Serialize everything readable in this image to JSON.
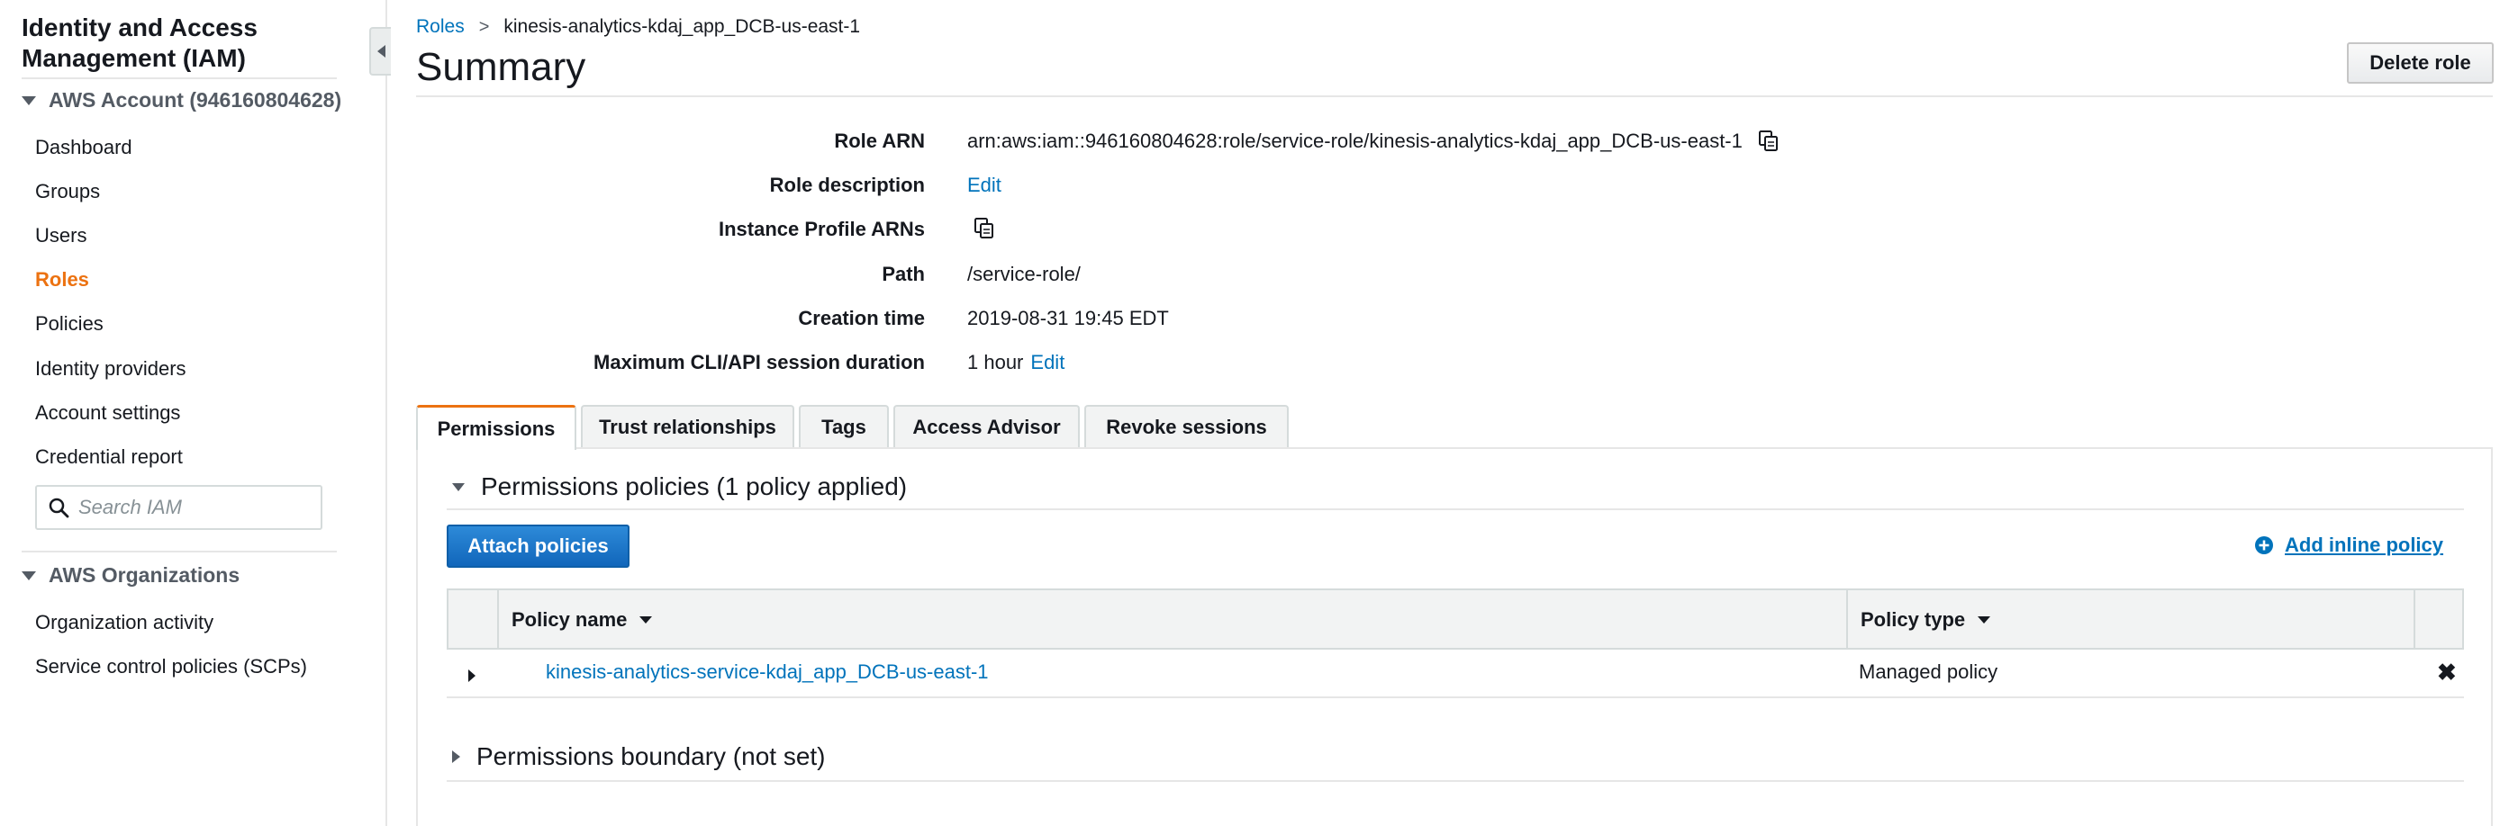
{
  "sidebar": {
    "title": "Identity and Access Management (IAM)",
    "account_group": "AWS Account (946160804628)",
    "items": [
      {
        "label": "Dashboard"
      },
      {
        "label": "Groups"
      },
      {
        "label": "Users"
      },
      {
        "label": "Roles",
        "active": true
      },
      {
        "label": "Policies"
      },
      {
        "label": "Identity providers"
      },
      {
        "label": "Account settings"
      },
      {
        "label": "Credential report"
      }
    ],
    "search_placeholder": "Search IAM",
    "org_group": "AWS Organizations",
    "org_items": [
      {
        "label": "Organization activity"
      },
      {
        "label": "Service control policies (SCPs)"
      }
    ]
  },
  "breadcrumb": {
    "parent": "Roles",
    "separator": ">",
    "current": "kinesis-analytics-kdaj_app_DCB-us-east-1"
  },
  "header": {
    "title": "Summary",
    "delete_label": "Delete role"
  },
  "summary": {
    "role_arn_label": "Role ARN",
    "role_arn_value": "arn:aws:iam::946160804628:role/service-role/kinesis-analytics-kdaj_app_DCB-us-east-1",
    "role_desc_label": "Role description",
    "role_desc_edit": "Edit",
    "instance_profile_label": "Instance Profile ARNs",
    "path_label": "Path",
    "path_value": "/service-role/",
    "creation_label": "Creation time",
    "creation_value": "2019-08-31 19:45 EDT",
    "max_session_label": "Maximum CLI/API session duration",
    "max_session_value": "1 hour",
    "max_session_edit": "Edit"
  },
  "tabs": [
    {
      "label": "Permissions",
      "active": true
    },
    {
      "label": "Trust relationships"
    },
    {
      "label": "Tags"
    },
    {
      "label": "Access Advisor"
    },
    {
      "label": "Revoke sessions"
    }
  ],
  "permissions": {
    "policies_heading": "Permissions policies (1 policy applied)",
    "attach_label": "Attach policies",
    "add_inline_label": "Add inline policy",
    "columns": {
      "name": "Policy name",
      "type": "Policy type"
    },
    "rows": [
      {
        "name": "kinesis-analytics-service-kdaj_app_DCB-us-east-1",
        "type": "Managed policy",
        "remove": "✖"
      }
    ],
    "boundary_heading": "Permissions boundary (not set)"
  },
  "colors": {
    "accent_orange": "#ec7211",
    "link_blue": "#0073bb",
    "primary_button": "#1166bb"
  }
}
